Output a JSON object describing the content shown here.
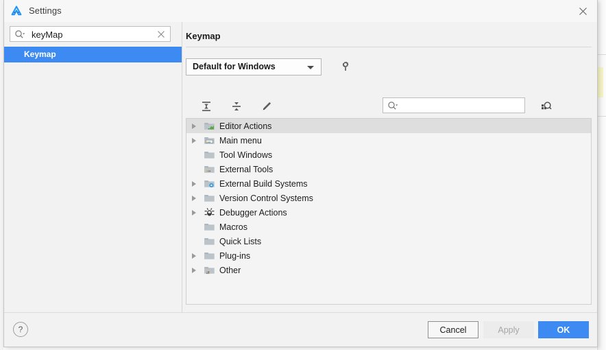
{
  "window": {
    "title": "Settings",
    "logo_icon": "android-studio-logo-icon",
    "close_icon": "close-icon"
  },
  "sidebar": {
    "search": {
      "value": "keyMap",
      "placeholder": "",
      "magnifier_icon": "search-icon",
      "clear_icon": "clear-icon"
    },
    "items": [
      {
        "label": "Keymap",
        "selected": true
      }
    ]
  },
  "content": {
    "title": "Keymap",
    "keymap_select": {
      "value": "Default for Windows",
      "arrow_icon": "chevron-down-icon"
    },
    "gear_icon": "gear-icon",
    "toolbar": {
      "expand_all_icon": "expand-all-icon",
      "collapse_all_icon": "collapse-all-icon",
      "edit_icon": "pencil-edit-icon",
      "find_shortcut_icon": "find-by-shortcut-icon",
      "search": {
        "value": "",
        "placeholder": "",
        "magnifier_icon": "search-icon"
      }
    },
    "tree": [
      {
        "label": "Editor Actions",
        "icon": "folder-editor-icon",
        "expandable": true,
        "selected": true
      },
      {
        "label": "Main menu",
        "icon": "folder-menu-icon",
        "expandable": true,
        "selected": false
      },
      {
        "label": "Tool Windows",
        "icon": "folder-icon",
        "expandable": false,
        "selected": false
      },
      {
        "label": "External Tools",
        "icon": "folder-tools-icon",
        "expandable": false,
        "selected": false
      },
      {
        "label": "External Build Systems",
        "icon": "folder-build-icon",
        "expandable": true,
        "selected": false
      },
      {
        "label": "Version Control Systems",
        "icon": "folder-icon",
        "expandable": true,
        "selected": false
      },
      {
        "label": "Debugger Actions",
        "icon": "bug-icon",
        "expandable": true,
        "selected": false
      },
      {
        "label": "Macros",
        "icon": "folder-icon",
        "expandable": false,
        "selected": false
      },
      {
        "label": "Quick Lists",
        "icon": "folder-icon",
        "expandable": false,
        "selected": false
      },
      {
        "label": "Plug-ins",
        "icon": "folder-icon",
        "expandable": true,
        "selected": false
      },
      {
        "label": "Other",
        "icon": "folder-other-icon",
        "expandable": true,
        "selected": false
      }
    ]
  },
  "footer": {
    "help_label": "?",
    "cancel_label": "Cancel",
    "apply_label": "Apply",
    "ok_label": "OK"
  },
  "colors": {
    "accent_blue": "#3d8bf2",
    "selection_grey": "#dedede",
    "dialog_bg": "#f2f2f2"
  }
}
